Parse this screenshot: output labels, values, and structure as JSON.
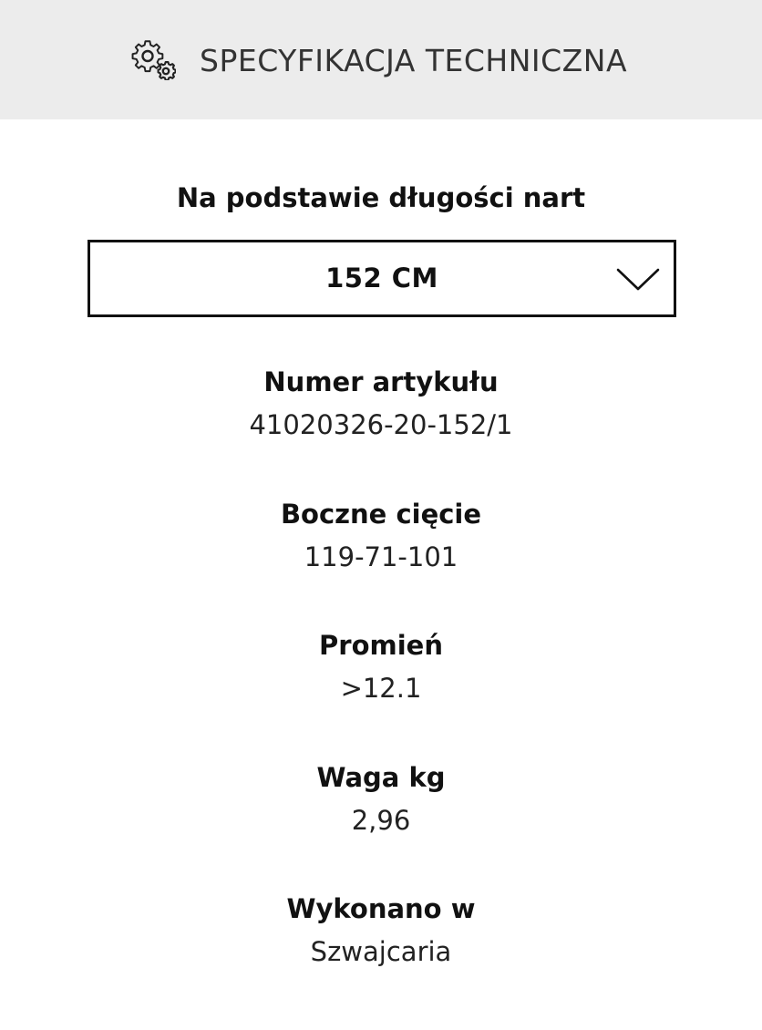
{
  "header": {
    "icon": "gear-icon",
    "title": "SPECYFIKACJA TECHNICZNA"
  },
  "length_selector": {
    "label": "Na podstawie długości nart",
    "selected": "152 CM",
    "icon": "chevron-down-icon"
  },
  "specs": [
    {
      "label": "Numer artykułu",
      "value": "41020326-20-152/1"
    },
    {
      "label": "Boczne cięcie",
      "value": "119-71-101"
    },
    {
      "label": "Promień",
      "value": ">12.1"
    },
    {
      "label": "Waga kg",
      "value": "2,96"
    },
    {
      "label": "Wykonano w",
      "value": "Szwajcaria"
    }
  ]
}
